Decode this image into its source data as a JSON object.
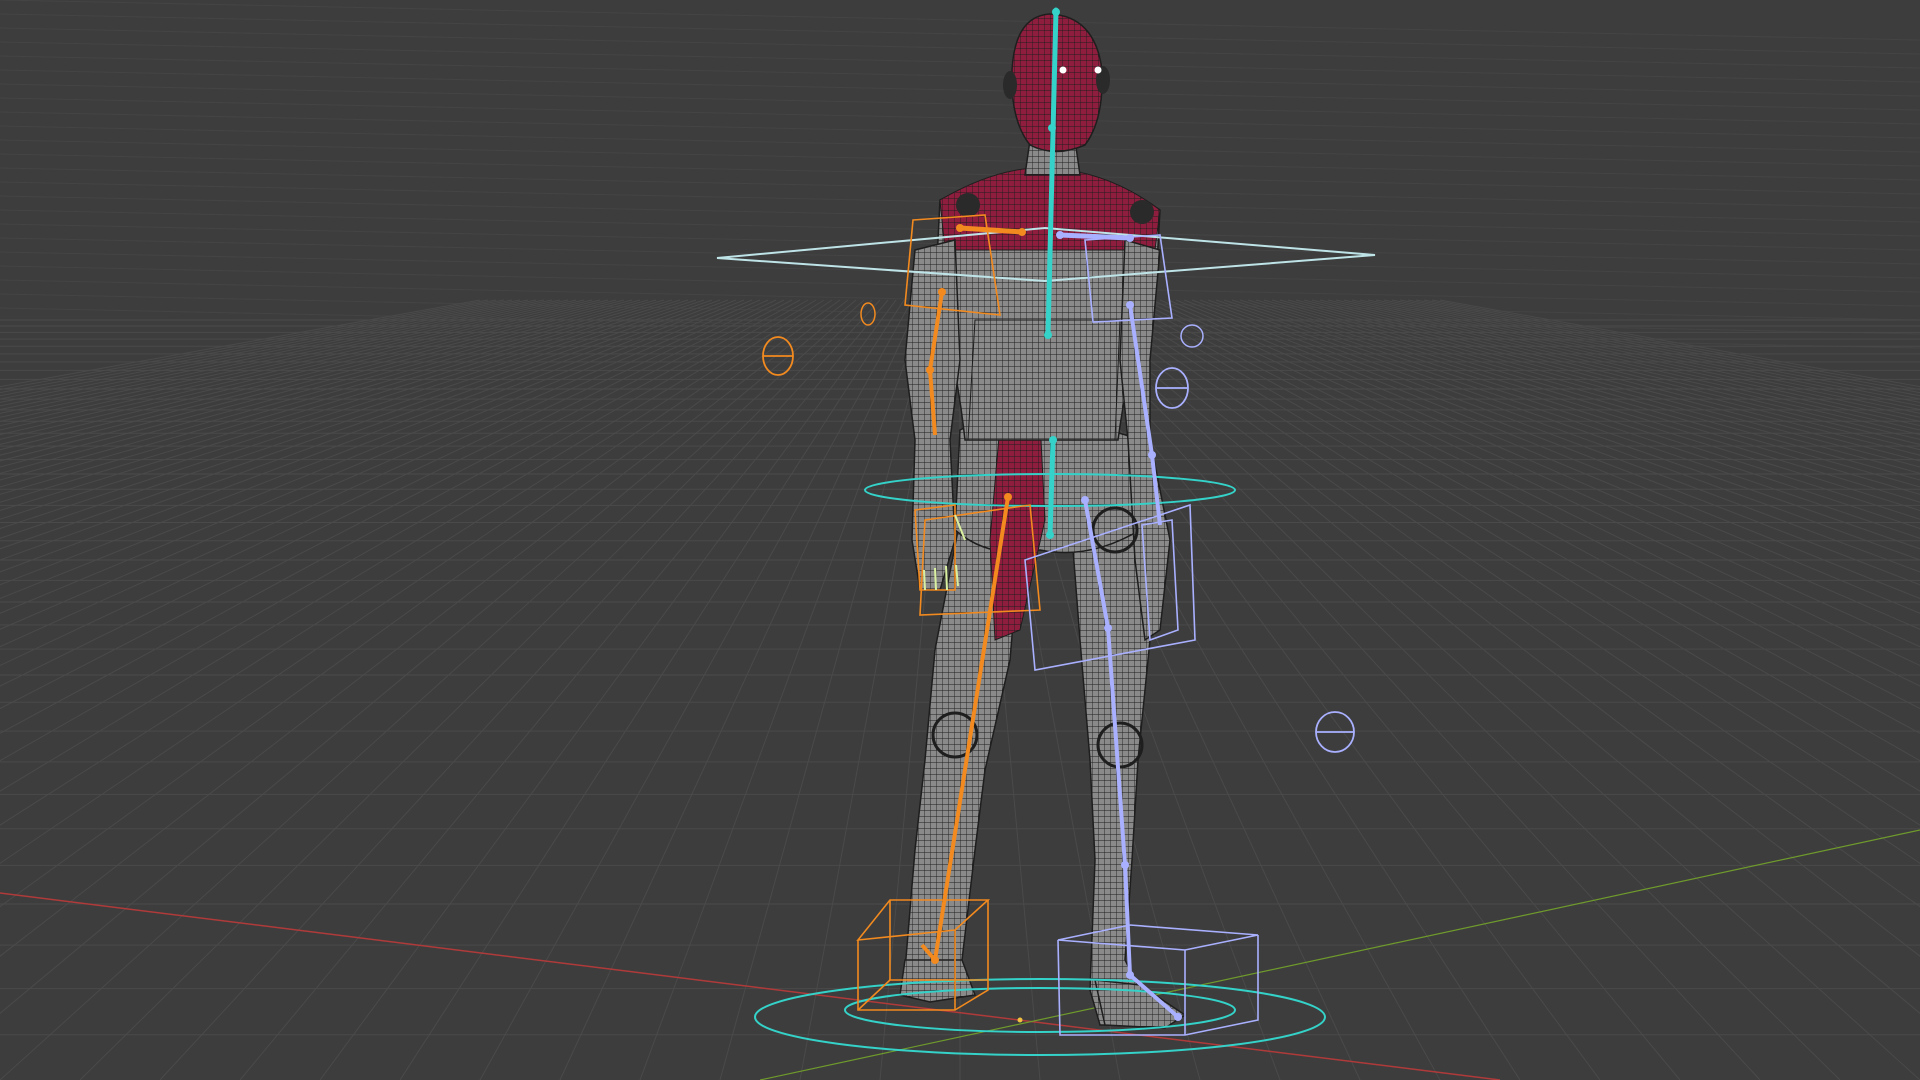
{
  "viewport": {
    "background": "#3d3d3d",
    "grid_color": "#4a4a4a",
    "x_axis_color": "#b03a3a",
    "y_axis_color": "#6f9a2c"
  },
  "rig": {
    "left_side_color": "#f28a1f",
    "right_side_color": "#a9b0ff",
    "center_color": "#34d2c8",
    "mesh_wire_color": "#1e1e1e",
    "mesh_body_color": "#8a8a8a",
    "mesh_accent_color": "#8f1e3e"
  }
}
